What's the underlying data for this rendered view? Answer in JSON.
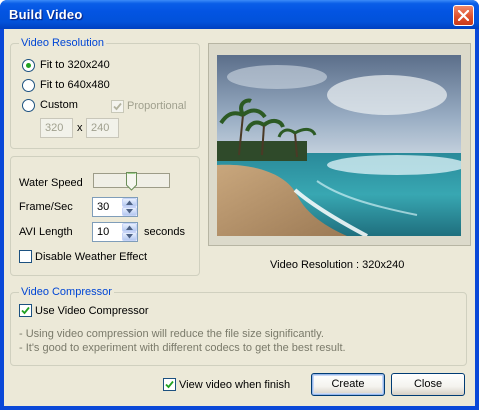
{
  "window": {
    "title": "Build Video"
  },
  "resolution_group": {
    "title": "Video Resolution",
    "options": [
      {
        "label": "Fit to 320x240",
        "selected": true
      },
      {
        "label": "Fit to 640x480",
        "selected": false
      },
      {
        "label": "Custom",
        "selected": false
      }
    ],
    "proportional_label": "Proportional",
    "proportional_checked": true,
    "width_value": "320",
    "height_value": "240",
    "separator": "x"
  },
  "settings_group": {
    "water_speed_label": "Water Speed",
    "water_speed_level": 0.5,
    "frame_label": "Frame/Sec",
    "frame_value": "30",
    "avi_label": "AVI Length",
    "avi_value": "10",
    "avi_unit": "seconds",
    "disable_weather_label": "Disable Weather Effect",
    "disable_weather_checked": false
  },
  "preview": {
    "caption": "Video Resolution : 320x240"
  },
  "compressor_group": {
    "title": "Video Compressor",
    "use_label": "Use Video Compressor",
    "use_checked": true,
    "help_lines": [
      "- Using video compression will reduce the file size significantly.",
      "- It's good to experiment with different codecs to get the best result."
    ]
  },
  "footer": {
    "view_when_finish_label": "View video when finish",
    "view_when_finish_checked": true,
    "create_label": "Create",
    "close_label": "Close"
  },
  "colors": {
    "titlebar": "#0252da",
    "dialog_bg": "#ece9d8",
    "group_title": "#0046d5",
    "check_green": "#21a121"
  }
}
